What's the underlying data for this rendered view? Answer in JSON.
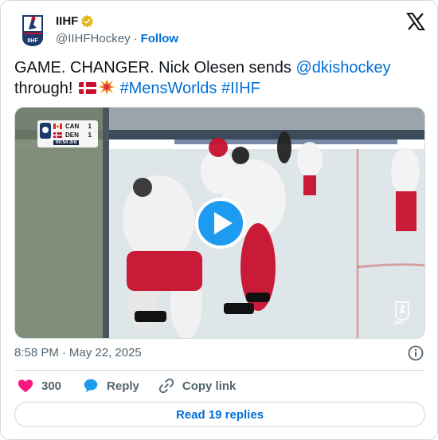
{
  "account": {
    "name": "IIHF",
    "handle": "@IIHFHockey",
    "separator": "·",
    "follow_label": "Follow",
    "logo_text": "IIHF"
  },
  "tweet": {
    "text_part1": "GAME. CHANGER. Nick Olesen sends ",
    "mention": "@dkishockey",
    "text_part2": " through! ",
    "hashtag1": "#MensWorlds",
    "hashtag2": "#IIHF",
    "emojis": [
      "flag-denmark-icon",
      "collision-icon"
    ]
  },
  "media": {
    "type": "video",
    "scoreboard": {
      "team1": {
        "code": "CAN",
        "score": "1"
      },
      "team2": {
        "code": "DEN",
        "score": "1"
      },
      "clock": "00:54",
      "period": "3rd"
    },
    "watermark_text": "IIHF"
  },
  "meta": {
    "time": "8:58 PM",
    "separator": "·",
    "date": "May 22, 2025"
  },
  "actions": {
    "likes_count": "300",
    "reply_label": "Reply",
    "copy_label": "Copy link"
  },
  "replies_button": "Read 19 replies",
  "colors": {
    "link": "#006fd6",
    "like": "#f91880",
    "reply": "#1d9bf0",
    "text": "#0f1419",
    "muted": "#536471",
    "border": "#cfd9de"
  }
}
